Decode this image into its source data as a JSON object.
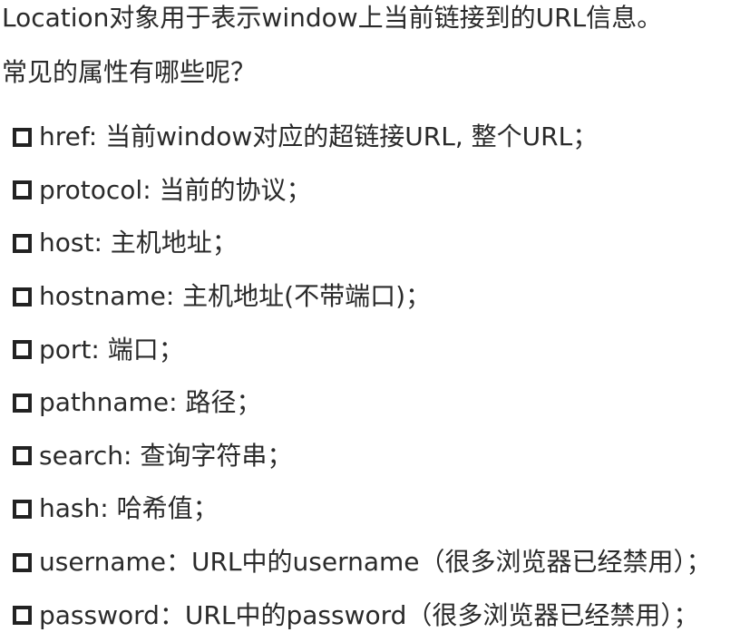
{
  "intro": [
    "Location对象用于表示window上当前链接到的URL信息。",
    "常见的属性有哪些呢？"
  ],
  "bullet_icon": "hollow-square-bullet",
  "text_color": "#2a2a2a",
  "items": [
    "href: 当前window对应的超链接URL, 整个URL；",
    "protocol: 当前的协议；",
    "host: 主机地址；",
    "hostname: 主机地址(不带端口)；",
    "port: 端口；",
    "pathname: 路径；",
    "search: 查询字符串；",
    "hash: 哈希值；",
    "username：URL中的username（很多浏览器已经禁用）；",
    "password：URL中的password（很多浏览器已经禁用）；"
  ]
}
